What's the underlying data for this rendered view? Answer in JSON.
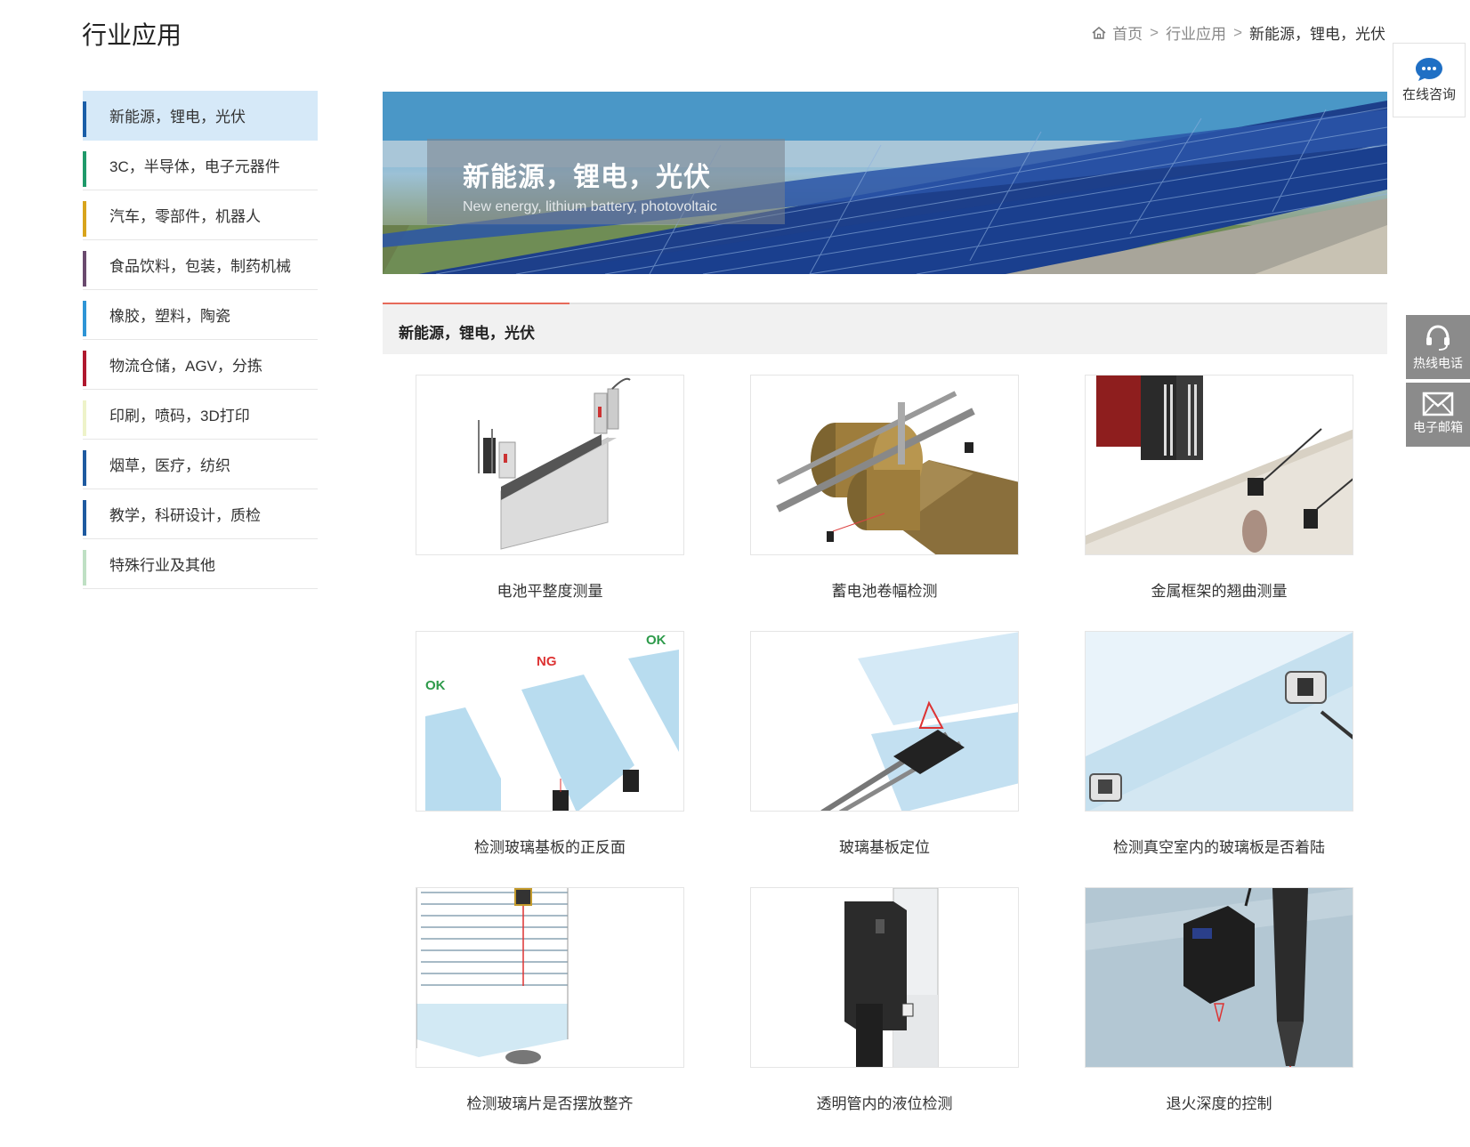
{
  "page": {
    "title": "行业应用"
  },
  "breadcrumb": {
    "home": "首页",
    "sep1": ">",
    "level1": "行业应用",
    "sep2": ">",
    "current": "新能源，锂电，光伏"
  },
  "sidebar": {
    "items": [
      {
        "label": "新能源，锂电，光伏",
        "color": "#1a5ea8",
        "active": true
      },
      {
        "label": "3C，半导体，电子元器件",
        "color": "#1f9a6a"
      },
      {
        "label": "汽车，零部件，机器人",
        "color": "#d8a41c"
      },
      {
        "label": "食品饮料，包装，制药机械",
        "color": "#6a4a6e"
      },
      {
        "label": "橡胶，塑料，陶瓷",
        "color": "#2e95d6"
      },
      {
        "label": "物流仓储，AGV，分拣",
        "color": "#b0182e"
      },
      {
        "label": "印刷，喷码，3D打印",
        "color": "#eef3c9"
      },
      {
        "label": "烟草，医疗，纺织",
        "color": "#1e5aa0"
      },
      {
        "label": "教学，科研设计，质检",
        "color": "#1e5aa0"
      },
      {
        "label": "特殊行业及其他",
        "color": "#bfe0c4"
      }
    ]
  },
  "banner": {
    "title": "新能源，锂电，光伏",
    "subtitle": "New energy, lithium battery, photovoltaic"
  },
  "section": {
    "title": "新能源，锂电，光伏"
  },
  "cards": [
    {
      "caption": "电池平整度测量",
      "icon": "battery-sensor-image"
    },
    {
      "caption": "蓄电池卷幅检测",
      "icon": "roll-width-image"
    },
    {
      "caption": "金属框架的翘曲测量",
      "icon": "metal-frame-image"
    },
    {
      "caption": "检测玻璃基板的正反面",
      "icon": "glass-side-image",
      "labels": {
        "ok1": "OK",
        "ng": "NG",
        "ok2": "OK"
      }
    },
    {
      "caption": "玻璃基板定位",
      "icon": "glass-position-image"
    },
    {
      "caption": "检测真空室内的玻璃板是否着陆",
      "icon": "vacuum-glass-image"
    },
    {
      "caption": "检测玻璃片是否摆放整齐",
      "icon": "glass-rack-image"
    },
    {
      "caption": "透明管内的液位检测",
      "icon": "tube-level-image"
    },
    {
      "caption": "退火深度的控制",
      "icon": "anneal-depth-image"
    }
  ],
  "floating": {
    "chat": "在线咨询",
    "phone": "热线电话",
    "email": "电子邮箱"
  }
}
